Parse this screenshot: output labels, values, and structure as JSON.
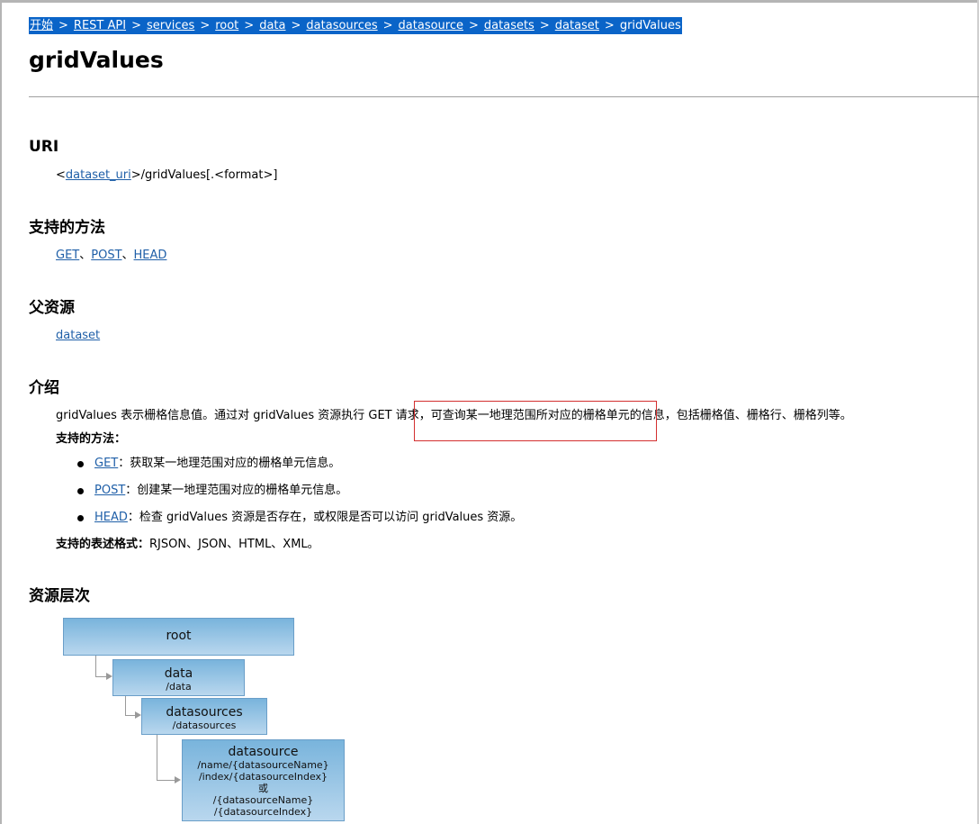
{
  "breadcrumb": {
    "items": [
      "开始",
      "REST API",
      "services",
      "root",
      "data",
      "datasources",
      "datasource",
      "datasets",
      "dataset"
    ],
    "current": "gridValues",
    "separator": ">"
  },
  "page_title": "gridValues",
  "uri": {
    "heading": "URI",
    "prefix": "<",
    "link": "dataset_uri",
    "suffix": ">/gridValues[.<format>]"
  },
  "methods": {
    "heading": "支持的方法",
    "items": [
      "GET",
      "POST",
      "HEAD"
    ],
    "sep": "、"
  },
  "parent": {
    "heading": "父资源",
    "link": "dataset"
  },
  "intro": {
    "heading": "介绍",
    "text_before": "gridValues 表示栅格信息值。通过对 gridValues 资源执行 GET 请求，",
    "text_highlight": "可查询某一地理范围所对应的栅格单元的信息",
    "text_after": "，包括栅格值、栅格行、栅格列等。",
    "methods_label": "支持的方法：",
    "method_items": [
      {
        "name": "GET",
        "desc": "：获取某一地理范围对应的栅格单元信息。"
      },
      {
        "name": "POST",
        "desc": "：创建某一地理范围对应的栅格单元信息。"
      },
      {
        "name": "HEAD",
        "desc": "：检查 gridValues 资源是否存在，或权限是否可以访问 gridValues 资源。"
      }
    ],
    "formats_label": "支持的表述格式：",
    "formats": "RJSON、JSON、HTML、XML。"
  },
  "hierarchy": {
    "heading": "资源层次",
    "nodes": [
      {
        "name": "root",
        "paths": []
      },
      {
        "name": "data",
        "paths": [
          "/data"
        ]
      },
      {
        "name": "datasources",
        "paths": [
          "/datasources"
        ]
      },
      {
        "name": "datasource",
        "paths": [
          "/name/{datasourceName}",
          "/index/{datasourceIndex}",
          "或",
          "/{datasourceName}",
          "/{datasourceIndex}"
        ]
      }
    ]
  },
  "colors": {
    "breadcrumb_bg": "#0a64c8",
    "link": "#1f5fa8",
    "highlight_border": "#d32f2f",
    "node_gradient_top": "#79b4dc",
    "node_gradient_bottom": "#b9d7ee"
  }
}
